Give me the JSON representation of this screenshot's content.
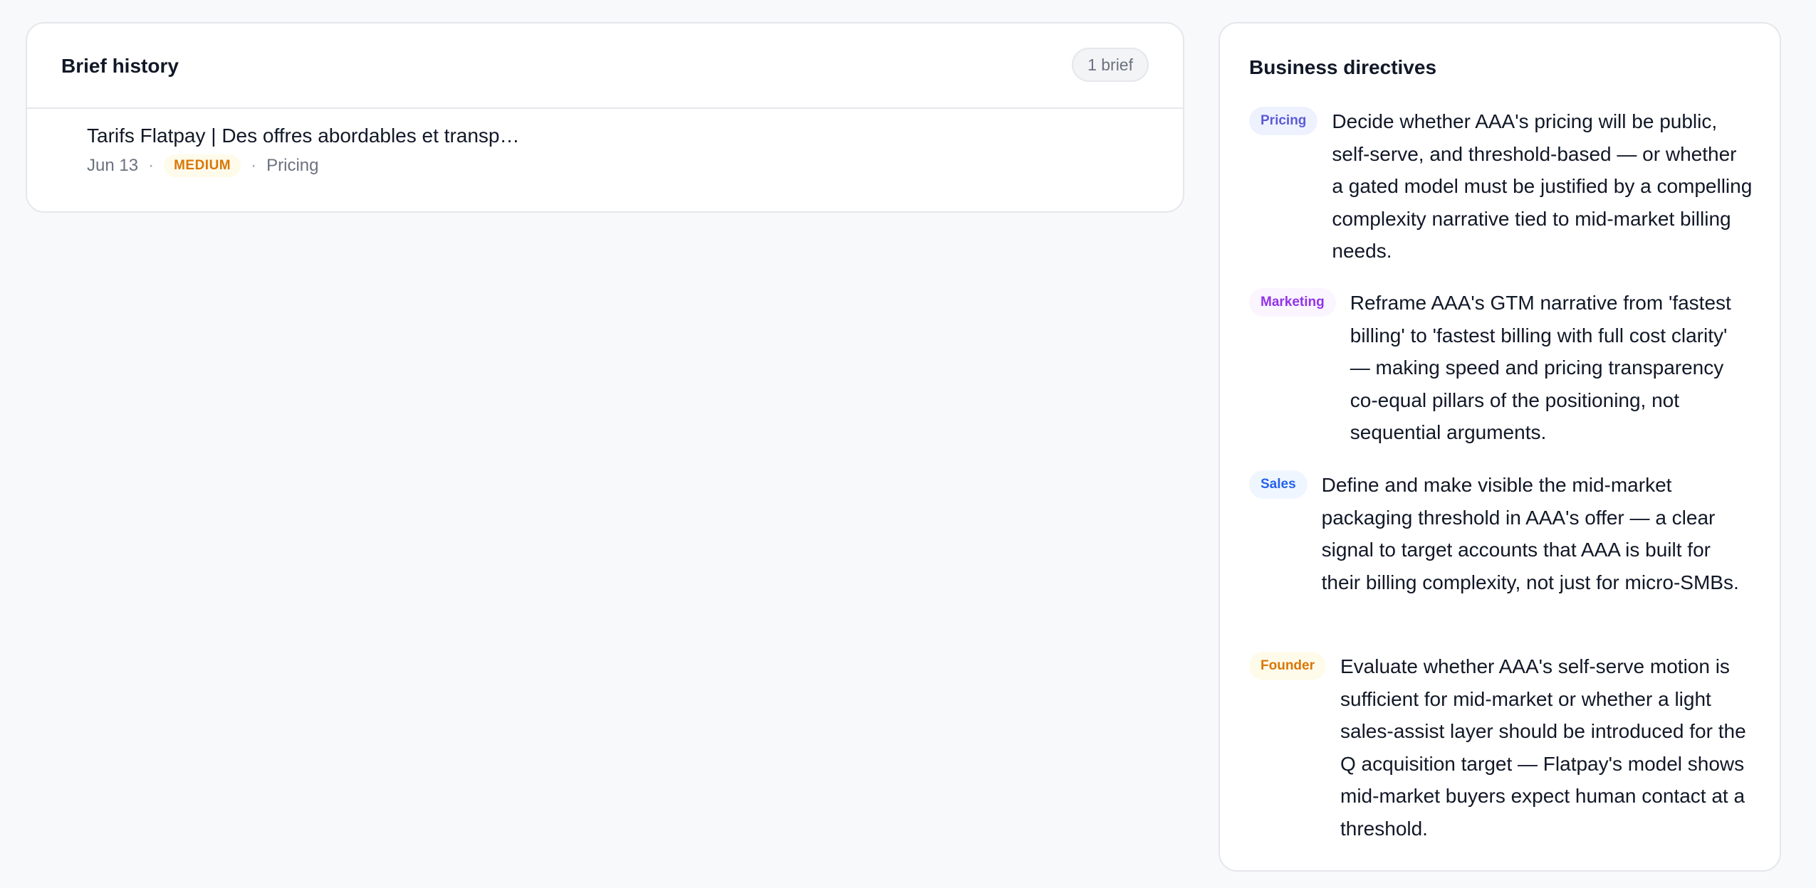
{
  "history": {
    "title": "Brief history",
    "count_label": "1 brief",
    "briefs": [
      {
        "title": "Tarifs Flatpay | Des offres abordables et transp…",
        "date": "Jun 13",
        "priority": "MEDIUM",
        "category": "Pricing"
      }
    ]
  },
  "directives": {
    "title": "Business directives",
    "items": [
      {
        "tag": "Pricing",
        "text": "Decide whether AAA's pricing will be public, self-serve, and threshold-based — or whether a gated model must be justified by a compelling complexity narrative tied to mid-market billing needs."
      },
      {
        "tag": "Marketing",
        "text": "Reframe AAA's GTM narrative from 'fastest billing' to 'fastest billing with full cost clarity' — making speed and pricing transparency co-equal pillars of the positioning, not sequential arguments."
      },
      {
        "tag": "Sales",
        "text": "Define and make visible the mid-market packaging threshold in AAA's offer — a clear signal to target accounts that AAA is built for their billing complexity, not just for micro-SMBs."
      },
      {
        "tag": "Founder",
        "text": "Evaluate whether AAA's self-serve motion is sufficient for mid-market or whether a light sales-assist layer should be introduced for the Q acquisition target — Flatpay's model shows mid-market buyers expect human contact at a threshold."
      }
    ]
  },
  "colors": {
    "background": "#f8f9fb",
    "card": "#ffffff",
    "border": "#e5e7eb",
    "text": "#111827",
    "muted": "#6b7280",
    "pricing": "#5b5bd6",
    "marketing": "#9333ea",
    "sales": "#2563eb",
    "founder": "#d97706"
  }
}
